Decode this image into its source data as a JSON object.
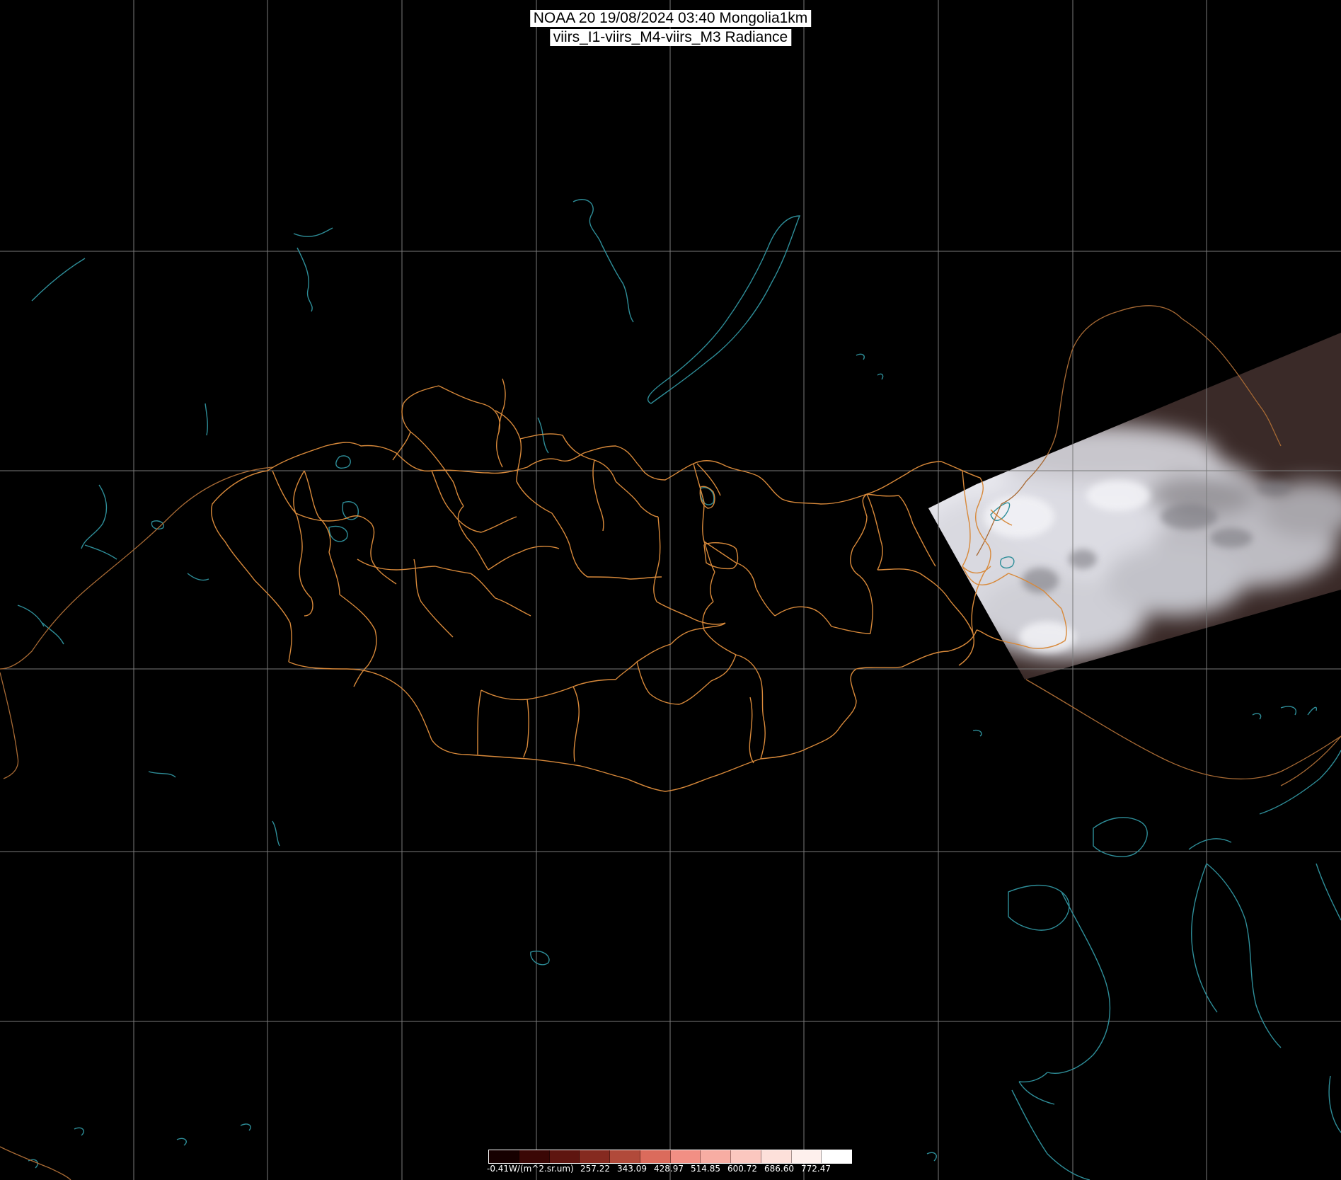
{
  "title": {
    "line1": "NOAA 20 19/08/2024 03:40 Mongolia1km",
    "line2": "viirs_I1-viirs_M4-viirs_M3 Radiance"
  },
  "colors": {
    "background": "#000000",
    "graticule": "#7a7a7a",
    "province_border": "#d8893a",
    "coast_water": "#2e8e99",
    "international_border": "#a86a34"
  },
  "legend": {
    "min_label": "-0.41W/(m^2.sr.um)",
    "tick_labels": [
      "257.22",
      "343.09",
      "428.97",
      "514.85",
      "600.72",
      "686.60",
      "772.47"
    ],
    "segments": [
      "#160000",
      "#3a0705",
      "#5e1510",
      "#852a20",
      "#b14a3a",
      "#db6b5c",
      "#f28f84",
      "#f7ada3",
      "#fbc7bf",
      "#fde0da",
      "#fef0ed",
      "#ffffff"
    ]
  }
}
